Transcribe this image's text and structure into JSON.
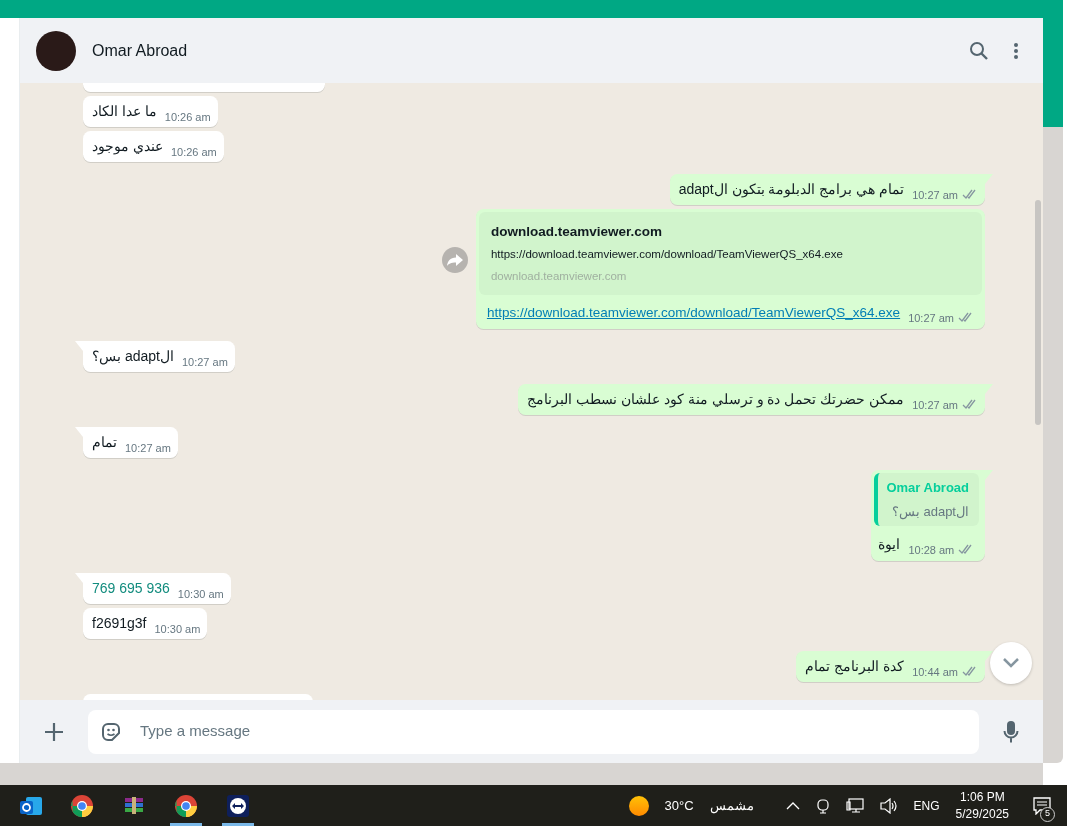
{
  "header": {
    "name": "Omar Abroad"
  },
  "messages": [
    {
      "kind": "partial",
      "outgoing": false
    },
    {
      "kind": "text",
      "outgoing": false,
      "tail": false,
      "text": "ما عدا الكاد",
      "time": "10:26 am"
    },
    {
      "kind": "text",
      "outgoing": false,
      "tail": false,
      "text": "عندي موجود",
      "time": "10:26 am"
    },
    {
      "kind": "text",
      "outgoing": true,
      "tail": true,
      "text": "تمام هي برامج الدبلومة بتكون الadapt",
      "time": "10:27 am"
    },
    {
      "kind": "link",
      "outgoing": true,
      "tail": false,
      "title": "download.teamviewer.com",
      "url": "https://download.teamviewer.com/download/TeamViewerQS_x64.exe",
      "domain": "download.teamviewer.com",
      "text": "https://download.teamviewer.com/download/TeamViewerQS_x64.exe",
      "time": "10:27 am"
    },
    {
      "kind": "text",
      "outgoing": false,
      "tail": true,
      "text": "الadapt بس؟",
      "time": "10:27 am"
    },
    {
      "kind": "text",
      "outgoing": true,
      "tail": true,
      "text": "ممكن حضرتك تحمل دة و ترسلي منة كود علشان نسطب البرنامج",
      "time": "10:27 am"
    },
    {
      "kind": "text",
      "outgoing": false,
      "tail": true,
      "text": "تمام",
      "time": "10:27 am"
    },
    {
      "kind": "reply",
      "outgoing": true,
      "tail": true,
      "quote_name": "Omar Abroad",
      "quote_text": "الadapt بس؟",
      "text": "ايوة",
      "time": "10:28 am"
    },
    {
      "kind": "phone",
      "outgoing": false,
      "tail": true,
      "text": "769 695 936",
      "time": "10:30 am"
    },
    {
      "kind": "text",
      "outgoing": false,
      "tail": false,
      "text": "f2691g3f",
      "time": "10:30 am"
    },
    {
      "kind": "text",
      "outgoing": true,
      "tail": true,
      "text": "كدة البرنامج تمام",
      "time": "10:44 am"
    },
    {
      "kind": "partial",
      "outgoing": false
    }
  ],
  "composer": {
    "placeholder": "Type a message"
  },
  "taskbar": {
    "apps": [
      {
        "kind": "outlook",
        "running": false
      },
      {
        "kind": "chrome",
        "running": false
      },
      {
        "kind": "archive",
        "running": false
      },
      {
        "kind": "chrome",
        "running": true
      },
      {
        "kind": "remote",
        "running": true
      }
    ],
    "weather": {
      "temperature": "30°C",
      "condition": "مشمس"
    },
    "language": "ENG",
    "time": "1:06 PM",
    "date": "5/29/2025",
    "notifications": "5"
  }
}
